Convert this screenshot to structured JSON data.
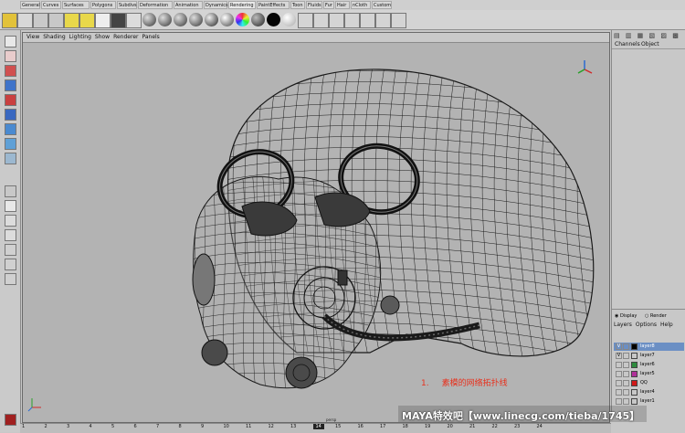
{
  "shelf": {
    "tabs": [
      "General",
      "Curves",
      "Surfaces",
      "Polygons",
      "Subdivs",
      "Deformation",
      "Animation",
      "Dynamics",
      "Rendering",
      "PaintEffects",
      "Toon",
      "Fluids",
      "Fur",
      "Hair",
      "nCloth",
      "Custom"
    ],
    "active_tab": "Rendering"
  },
  "viewport": {
    "menu": [
      "View",
      "Shading",
      "Lighting",
      "Show",
      "Renderer",
      "Panels"
    ],
    "annotation_number": "1.",
    "annotation_text": "素模的网络拓扑线",
    "camera_label": "persp"
  },
  "channel_box": {
    "menu": [
      "Channels",
      "Object"
    ]
  },
  "layer_editor": {
    "mode_display": "Display",
    "mode_render": "Render",
    "menu": [
      "Layers",
      "Options",
      "Help"
    ],
    "layers": [
      {
        "name": "layer8",
        "visible": "V",
        "color": "#000000",
        "selected": true
      },
      {
        "name": "layer7",
        "visible": "V",
        "color": "#c8c8c8",
        "selected": false
      },
      {
        "name": "layer6",
        "visible": "",
        "color": "#2e8b3e",
        "selected": false
      },
      {
        "name": "layer5",
        "visible": "",
        "color": "#b0309a",
        "selected": false
      },
      {
        "name": "QQ",
        "visible": "",
        "color": "#d01818",
        "selected": false
      },
      {
        "name": "layer4",
        "visible": "",
        "color": "#c8c8c8",
        "selected": false
      },
      {
        "name": "layer1",
        "visible": "",
        "color": "#c8c8c8",
        "selected": false
      }
    ]
  },
  "timeline": {
    "ticks": [
      "1",
      "2",
      "3",
      "4",
      "5",
      "6",
      "7",
      "8",
      "9",
      "10",
      "11",
      "12",
      "13",
      "14",
      "15",
      "16",
      "17",
      "18",
      "19",
      "20",
      "21",
      "22",
      "23",
      "24"
    ],
    "current_frame": "14"
  },
  "watermark": "MAYA特效吧【www.linecg.com/tieba/1745】",
  "colors": {
    "viewport_bg": "#b3b3b3",
    "wire": "#1a1a1a",
    "annotation": "#e8301c",
    "selected_layer": "#6b8fc4"
  }
}
